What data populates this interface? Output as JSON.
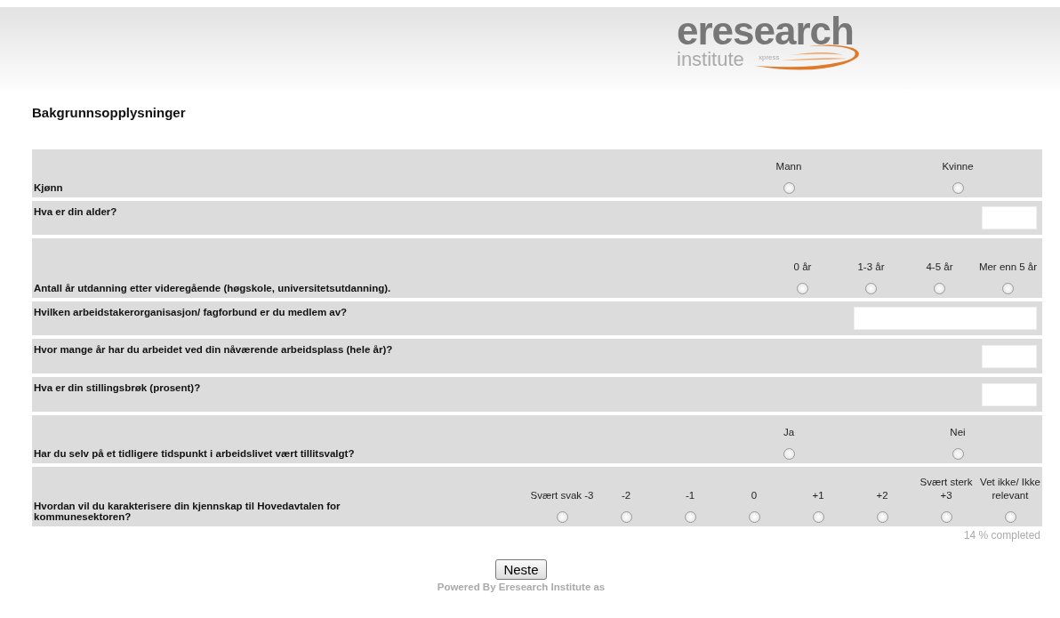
{
  "logo": {
    "name": "eresearch",
    "sub": "institute",
    "tag": "xpress"
  },
  "title": "Bakgrunnsopplysninger",
  "questions": [
    {
      "kind": "radio",
      "text": "Kjønn",
      "options": [
        {
          "label": "Mann",
          "selected": false
        },
        {
          "label": "Kvinne",
          "selected": false
        }
      ]
    },
    {
      "kind": "short_text",
      "text": "Hva er din alder?"
    },
    {
      "kind": "radio",
      "text": "Antall år utdanning etter videregående (høgskole, universitetsutdanning).",
      "options": [
        {
          "label": "0 år",
          "selected": false
        },
        {
          "label": "1-3 år",
          "selected": false
        },
        {
          "label": "4-5 år",
          "selected": false
        },
        {
          "label": "Mer enn 5 år",
          "selected": false
        }
      ]
    },
    {
      "kind": "long_text",
      "text": "Hvilken arbeidstakerorganisasjon/ fagforbund er du medlem av?"
    },
    {
      "kind": "short_text",
      "text": "Hvor mange år har du arbeidet ved din nåværende arbeidsplass (hele år)?"
    },
    {
      "kind": "short_text",
      "text": "Hva er din stillingsbrøk (prosent)?"
    },
    {
      "kind": "radio",
      "text": "Har du selv på et tidligere tidspunkt i arbeidslivet vært tillitsvalgt?",
      "options": [
        {
          "label": "Ja",
          "selected": false
        },
        {
          "label": "Nei",
          "selected": false
        }
      ]
    },
    {
      "kind": "radio",
      "text": "Hvordan vil du karakterisere din kjennskap til Hovedavtalen for kommunesektoren?",
      "options": [
        {
          "label": "Svært svak -3",
          "selected": false
        },
        {
          "label": "-2",
          "selected": false
        },
        {
          "label": "-1",
          "selected": false
        },
        {
          "label": "0",
          "selected": false
        },
        {
          "label": "+1",
          "selected": false
        },
        {
          "label": "+2",
          "selected": false
        },
        {
          "label": "Svært sterk +3",
          "selected": false
        },
        {
          "label": "Vet ikke/ Ikke relevant",
          "selected": false
        }
      ]
    }
  ],
  "progress": "14 % completed",
  "next_button": "Neste",
  "footer": "Powered By Eresearch Institute as"
}
